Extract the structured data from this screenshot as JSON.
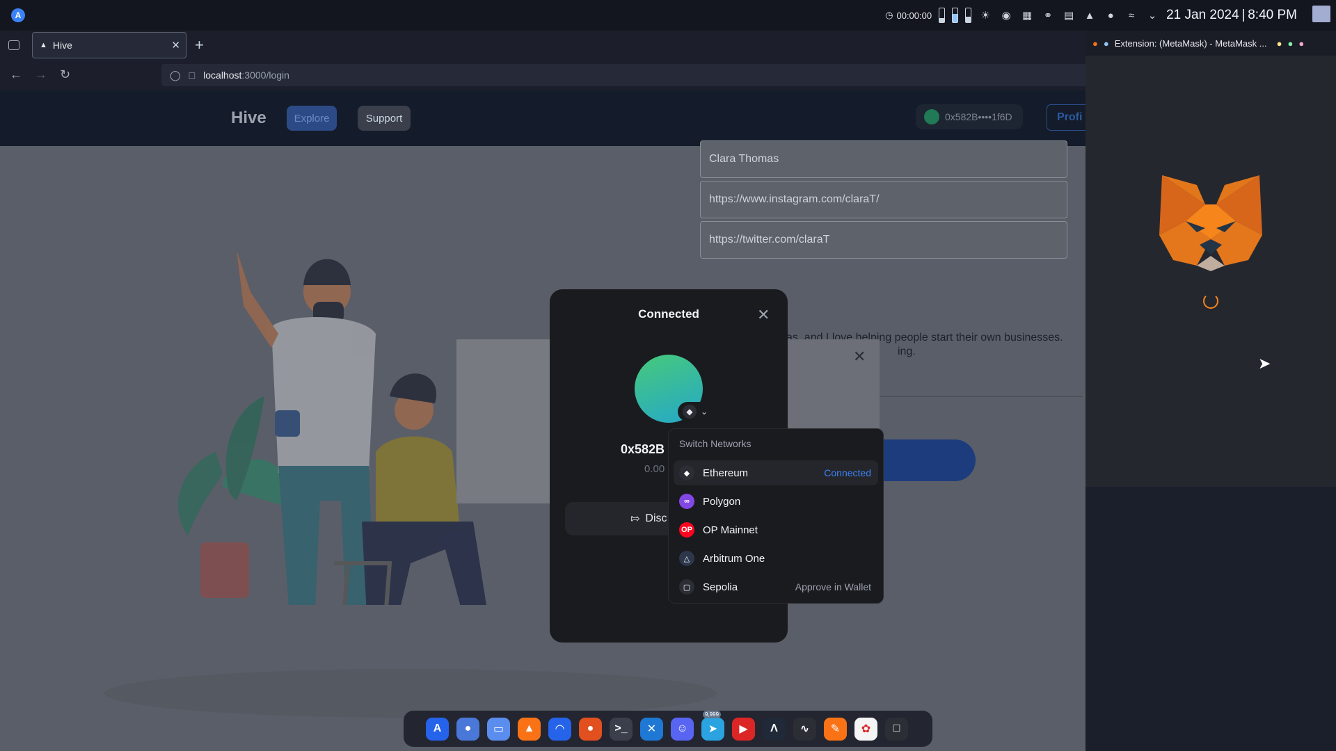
{
  "system_bar": {
    "timer": "00:00:00",
    "clock": "21 Jan 2024 | 8:40 PM",
    "icons": [
      "timer-icon",
      "battery-icon",
      "notification-icon",
      "discord-icon",
      "app-icon",
      "headset-icon",
      "clipboard-icon",
      "volume-icon",
      "mic-icon",
      "wifi-icon",
      "chevron-down-icon"
    ]
  },
  "browser": {
    "tab_title": "Hive",
    "url_host": "localhost",
    "url_path": ":3000/login"
  },
  "app": {
    "brand": "Hive",
    "nav": {
      "explore": "Explore",
      "support": "Support"
    },
    "wallet_address_short": "0x582B••••1f6D",
    "profile_button": "Profi",
    "form": {
      "name": "Clara Thomas",
      "instagram": "https://www.instagram.com/claraT/",
      "twitter": "https://twitter.com/claraT",
      "bio_line1": "as, and I love helping people start their own businesses.",
      "bio_line2": "ing."
    }
  },
  "connected_modal": {
    "title": "Connected",
    "address": "0x582B",
    "balance": "0.00",
    "disconnect_label": "Disc"
  },
  "network_menu": {
    "title": "Switch Networks",
    "networks": [
      {
        "name": "Ethereum",
        "status": "Connected",
        "status_color": "#3b82f6",
        "icon_color": "#2b2e35",
        "icon": "eth-icon"
      },
      {
        "name": "Polygon",
        "status": "",
        "icon_color": "#8247e5",
        "icon": "polygon-icon"
      },
      {
        "name": "OP Mainnet",
        "status": "",
        "icon_color": "#ff0420",
        "icon": "op-icon"
      },
      {
        "name": "Arbitrum One",
        "status": "",
        "icon_color": "#2d374b",
        "icon": "arbitrum-icon"
      },
      {
        "name": "Sepolia",
        "status": "Approve in Wallet",
        "status_color": "#9ca3af",
        "icon_color": "#2b2e35",
        "icon": "sepolia-icon"
      }
    ]
  },
  "metamask": {
    "window_title": "Extension: (MetaMask) - MetaMask ..."
  },
  "dock": {
    "badge": "9,999",
    "apps": [
      {
        "name": "launcher",
        "color": "#2563eb"
      },
      {
        "name": "settings",
        "color": "#4a78d8"
      },
      {
        "name": "files",
        "color": "#5b8def"
      },
      {
        "name": "brave",
        "color": "#f97316"
      },
      {
        "name": "mail",
        "color": "#2563eb"
      },
      {
        "name": "firefox",
        "color": "#e1501e"
      },
      {
        "name": "terminal",
        "color": "#3a3f4b"
      },
      {
        "name": "vscode",
        "color": "#1e78d4"
      },
      {
        "name": "discord",
        "color": "#5865f2"
      },
      {
        "name": "telegram",
        "color": "#2aa3e0"
      },
      {
        "name": "media",
        "color": "#dc2626"
      },
      {
        "name": "ide",
        "color": "#1f2937"
      },
      {
        "name": "tool",
        "color": "#2b2e35"
      },
      {
        "name": "pen",
        "color": "#f97316"
      },
      {
        "name": "photos",
        "color": "#f5f5f5"
      },
      {
        "name": "screen",
        "color": "#2b2e35"
      }
    ]
  }
}
